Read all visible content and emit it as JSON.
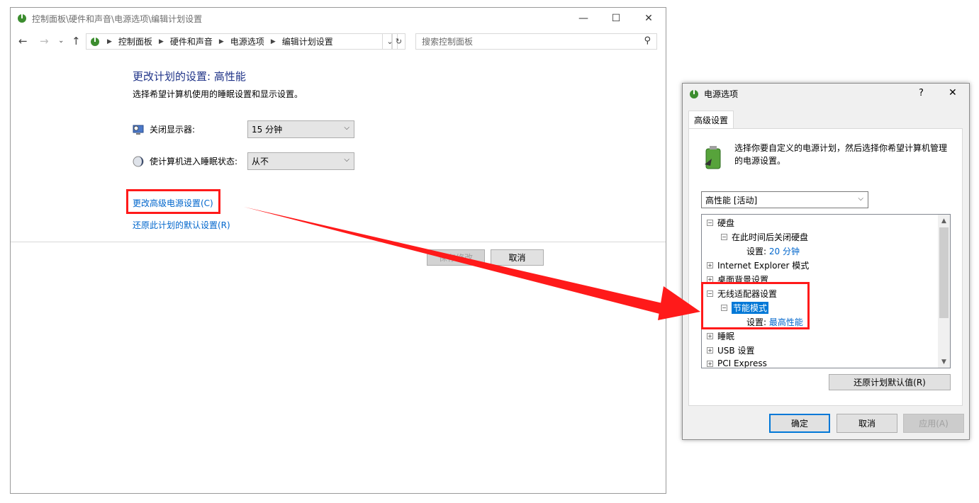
{
  "main_window": {
    "title": "控制面板\\硬件和声音\\电源选项\\编辑计划设置",
    "breadcrumb": [
      "控制面板",
      "硬件和声音",
      "电源选项",
      "编辑计划设置"
    ],
    "search_placeholder": "搜索控制面板",
    "heading": "更改计划的设置: 高性能",
    "subheading": "选择希望计算机使用的睡眠设置和显示设置。",
    "display_off_label": "关闭显示器:",
    "display_off_value": "15 分钟",
    "sleep_label": "使计算机进入睡眠状态:",
    "sleep_value": "从不",
    "advanced_link": "更改高级电源设置(C)",
    "restore_link": "还原此计划的默认设置(R)",
    "save_button": "保存修改",
    "cancel_button": "取消"
  },
  "dialog": {
    "title": "电源选项",
    "help": "?",
    "tab": "高级设置",
    "description": "选择你要自定义的电源计划，然后选择你希望计算机管理的电源设置。",
    "plan_select": "高性能 [活动]",
    "tree": [
      {
        "label": "硬盘",
        "toggle": "⊟",
        "level": 0
      },
      {
        "label": "在此时间后关闭硬盘",
        "toggle": "⊟",
        "level": 1
      },
      {
        "label": "设置:",
        "value": "20 分钟",
        "level": 2
      },
      {
        "label": "Internet Explorer 模式",
        "toggle": "⊞",
        "level": 0
      },
      {
        "label": "桌面背景设置",
        "toggle": "⊞",
        "level": 0
      },
      {
        "label": "无线适配器设置",
        "toggle": "⊟",
        "level": 0
      },
      {
        "label": "节能模式",
        "toggle": "⊟",
        "level": 1,
        "selected": true
      },
      {
        "label": "设置:",
        "value": "最高性能",
        "level": 2
      },
      {
        "label": "睡眠",
        "toggle": "⊞",
        "level": 0
      },
      {
        "label": "USB 设置",
        "toggle": "⊞",
        "level": 0
      },
      {
        "label": "PCI Express",
        "toggle": "⊞",
        "level": 0
      }
    ],
    "restore_defaults": "还原计划默认值(R)",
    "ok": "确定",
    "cancel": "取消",
    "apply": "应用(A)"
  },
  "colors": {
    "annotation": "#ff1a1a",
    "link": "#0066cc",
    "heading": "#1e3287",
    "selection": "#0078d7"
  }
}
